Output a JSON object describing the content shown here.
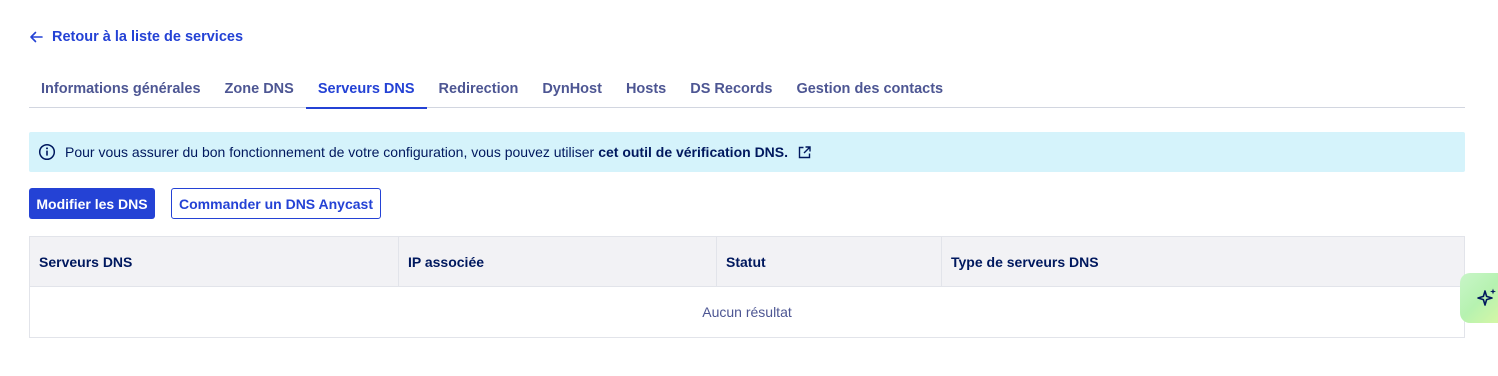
{
  "back_link": {
    "label": "Retour à la liste de services",
    "icon": "arrow-left-icon"
  },
  "tabs": [
    {
      "label": "Informations générales",
      "active": false
    },
    {
      "label": "Zone DNS",
      "active": false
    },
    {
      "label": "Serveurs DNS",
      "active": true
    },
    {
      "label": "Redirection",
      "active": false
    },
    {
      "label": "DynHost",
      "active": false
    },
    {
      "label": "Hosts",
      "active": false
    },
    {
      "label": "DS Records",
      "active": false
    },
    {
      "label": "Gestion des contacts",
      "active": false
    }
  ],
  "info_banner": {
    "icon": "info-icon",
    "text": "Pour vous assurer du bon fonctionnement de votre configuration, vous pouvez utiliser",
    "link_label": "cet outil de vérification DNS.",
    "link_icon": "external-link-icon"
  },
  "actions": {
    "modify_label": "Modifier les DNS",
    "order_label": "Commander un DNS Anycast"
  },
  "table": {
    "columns": [
      "Serveurs DNS",
      "IP associée",
      "Statut",
      "Type de serveurs DNS"
    ],
    "empty_text": "Aucun résultat"
  },
  "ai_assistant": {
    "icon": "sparkles-icon"
  },
  "colors": {
    "primary": "#2442d5",
    "text_dark": "#00185e",
    "text_muted": "#4d5693",
    "info_bg": "#d5f3fb",
    "header_bg": "#f2f2f5"
  }
}
